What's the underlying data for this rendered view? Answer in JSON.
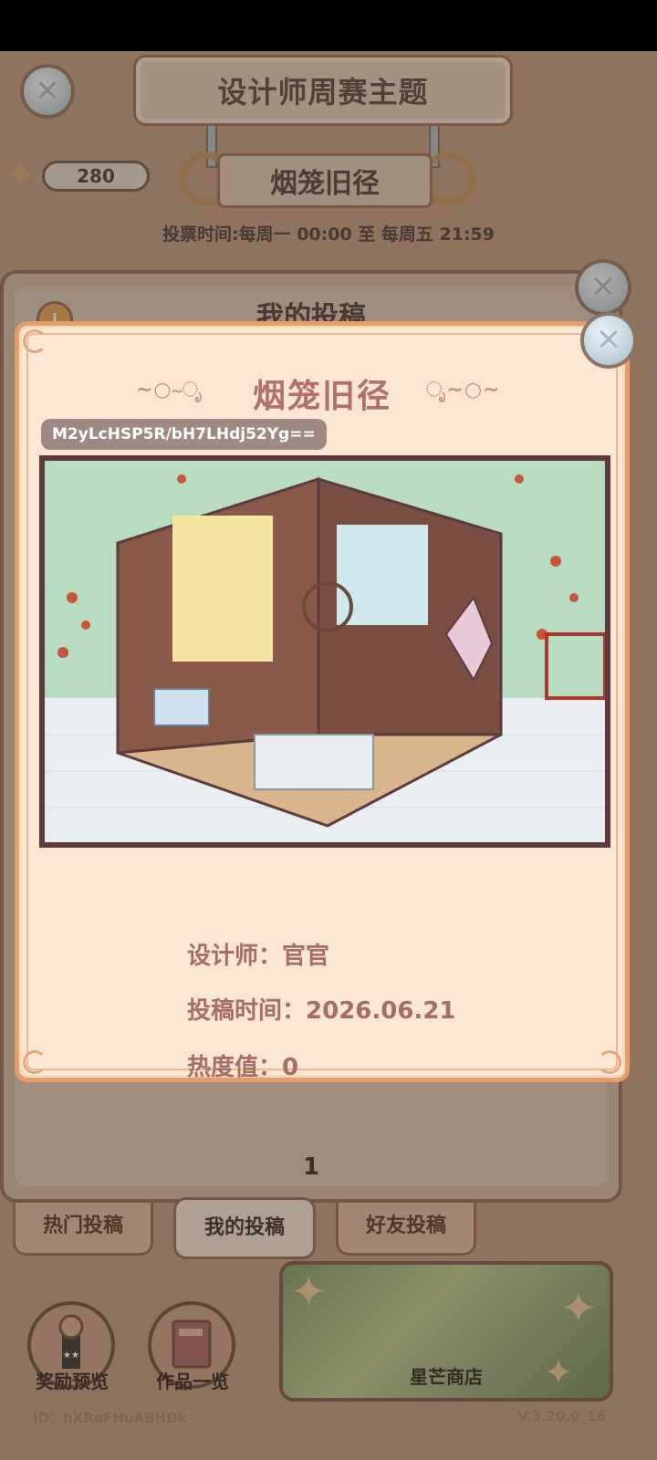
{
  "header": {
    "title": "设计师周赛主题",
    "theme": "烟笼旧径",
    "vote_time": "投票时间:每周一 00:00 至 每周五 21:59",
    "star_count": "280"
  },
  "background_panel": {
    "title": "我的投稿",
    "page": "1"
  },
  "tabs": [
    {
      "label": "热门投稿"
    },
    {
      "label": "我的投稿"
    },
    {
      "label": "好友投稿"
    }
  ],
  "bottom": {
    "reward_label": "奖励预览",
    "works_label": "作品一览",
    "shop_label": "星芒商店",
    "user_id": "ID：hXRoFHuABHDk",
    "version": "V.3.20.0_16"
  },
  "modal": {
    "title": "烟笼旧径",
    "code": "M2yLcHSP5R/bH7LHdj52Yg==",
    "designer_label": "设计师：",
    "designer": "官官",
    "submit_time_label": "投稿时间：",
    "submit_time": "2026.06.21",
    "heat_label": "热度值：",
    "heat": "0"
  },
  "colors": {
    "modal_bg": "#fbe6d2",
    "modal_border": "#e59d6a",
    "accent_text": "#b1706b",
    "panel_brown": "#8e6b5b"
  },
  "icons": [
    "close-icon",
    "star-icon",
    "info-icon",
    "trophy-icon",
    "book-icon"
  ]
}
